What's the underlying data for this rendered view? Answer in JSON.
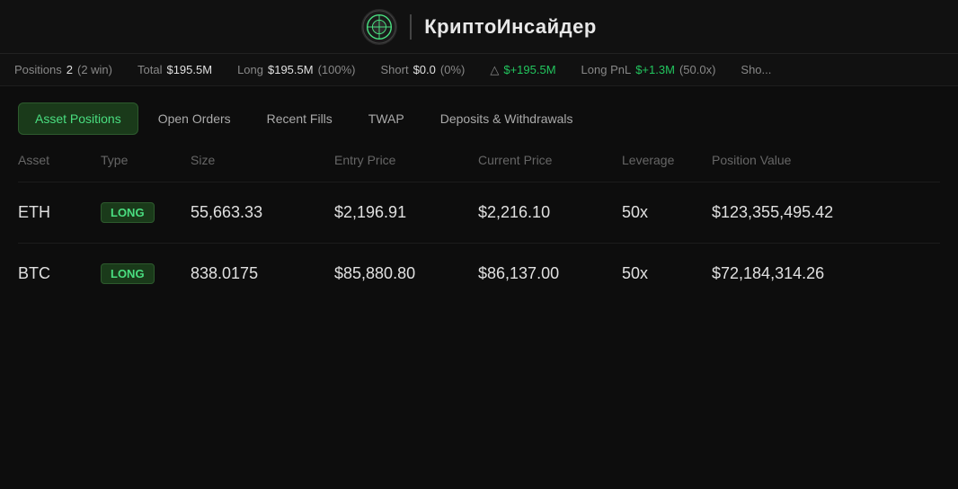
{
  "header": {
    "title": "КриптоИнсайдер",
    "logo_alt": "logo"
  },
  "ticker": {
    "items": [
      {
        "id": "positions",
        "label": "Positions",
        "value": "2",
        "extra": "(2 win)"
      },
      {
        "id": "total",
        "label": "Total",
        "value": "$195.5M"
      },
      {
        "id": "long",
        "label": "Long",
        "value": "$195.5M",
        "extra": "(100%)"
      },
      {
        "id": "short",
        "label": "Short",
        "value": "$0.0",
        "extra": "(0%)"
      },
      {
        "id": "delta",
        "label": "△",
        "value": "$+195.5M",
        "green": true
      },
      {
        "id": "longpnl",
        "label": "Long PnL",
        "value": "$+1.3M",
        "extra": "(50.0x)",
        "green": true
      },
      {
        "id": "sho",
        "label": "Sho...",
        "value": ""
      }
    ]
  },
  "tabs": [
    {
      "id": "asset-positions",
      "label": "Asset Positions",
      "active": true
    },
    {
      "id": "open-orders",
      "label": "Open Orders",
      "active": false
    },
    {
      "id": "recent-fills",
      "label": "Recent Fills",
      "active": false
    },
    {
      "id": "twap",
      "label": "TWAP",
      "active": false
    },
    {
      "id": "deposits-withdrawals",
      "label": "Deposits & Withdrawals",
      "active": false
    }
  ],
  "table": {
    "columns": [
      {
        "id": "asset",
        "label": "Asset"
      },
      {
        "id": "type",
        "label": "Type"
      },
      {
        "id": "size",
        "label": "Size"
      },
      {
        "id": "entry-price",
        "label": "Entry Price"
      },
      {
        "id": "current-price",
        "label": "Current Price"
      },
      {
        "id": "leverage",
        "label": "Leverage"
      },
      {
        "id": "position-value",
        "label": "Position Value"
      }
    ],
    "rows": [
      {
        "asset": "ETH",
        "type": "LONG",
        "size": "55,663.33",
        "entry_price": "$2,196.91",
        "current_price": "$2,216.10",
        "leverage": "50x",
        "position_value": "$123,355,495.42"
      },
      {
        "asset": "BTC",
        "type": "LONG",
        "size": "838.0175",
        "entry_price": "$85,880.80",
        "current_price": "$86,137.00",
        "leverage": "50x",
        "position_value": "$72,184,314.26"
      }
    ]
  }
}
